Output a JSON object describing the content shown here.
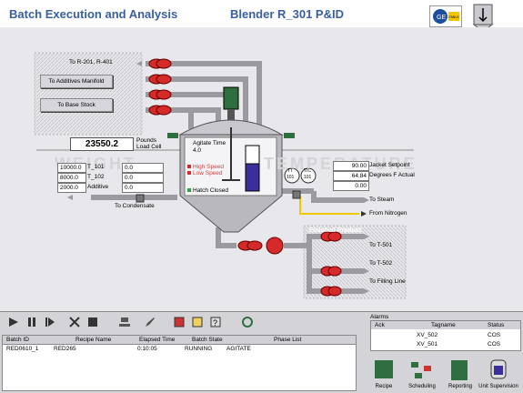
{
  "header": {
    "title": "Batch Execution and Analysis",
    "subtitle": "Blender R_301 P&ID",
    "logo_icon": "ge-fanuc-logo",
    "home_icon": "reactor-home-icon"
  },
  "pid": {
    "routes_top": "To R-201, R-401",
    "additives_button": "To Additives Manifold",
    "basestock_button": "To Base Stock",
    "load_cell_value": "23550.2",
    "load_cell_units": "Pounds",
    "load_cell_label": "Load Cell",
    "agitate_time_label": "Agitate Time",
    "agitate_time_value": "4.0",
    "high_speed": "High Speed",
    "low_speed": "Low Speed",
    "hatch_closed": "Hatch Closed",
    "watermark_left": "WEIGHT",
    "watermark_right": "TEMPERATURE",
    "tanks": [
      {
        "target": "10000.0",
        "name": "T_101",
        "actual": "0.0"
      },
      {
        "target": "8000.0",
        "name": "T_102",
        "actual": "0.0"
      },
      {
        "target": "2000.0",
        "name": "Additive",
        "actual": "0.0"
      }
    ],
    "jacket_setpoint_value": "90.00",
    "jacket_setpoint_label": "Jacket Setpoint",
    "degrees_actual_value": "64.84",
    "degrees_actual_label": "Degrees F Actual",
    "third_value": "0.00",
    "tt_label": "TT",
    "tt_num": "101",
    "tic_label": "TIC",
    "tic_num": "101",
    "to_steam": "To Steam",
    "from_nitrogen": "From Nitrogen",
    "to_condensate": "To Condensate",
    "finished_product": "Finished Product",
    "to_t501": "To T-501",
    "to_t502": "To T-502",
    "to_filling": "To Filling Line"
  },
  "batch_table": {
    "headers": [
      "Batch ID",
      "Recipe Name",
      "Elapsed Time",
      "Batch State",
      "Phase List"
    ],
    "rows": [
      [
        "RED0610_1",
        "RED265",
        "0:10:05",
        "RUNNING",
        "AGITATE"
      ]
    ]
  },
  "alarms": {
    "title": "Alarms",
    "headers": [
      "Ack",
      "Tagname",
      "Status"
    ],
    "rows": [
      [
        "",
        "XV_502",
        "COS"
      ],
      [
        "",
        "XV_501",
        "COS"
      ]
    ]
  },
  "nav": [
    "Recipe",
    "Scheduling",
    "Reporting",
    "Unit Supervision"
  ],
  "colors": {
    "title": "#3a5f9e",
    "valve": "#d42a2a",
    "pipe": "#a8a8ae",
    "level": "#3a2f9a",
    "motor": "#2f6e3e"
  }
}
